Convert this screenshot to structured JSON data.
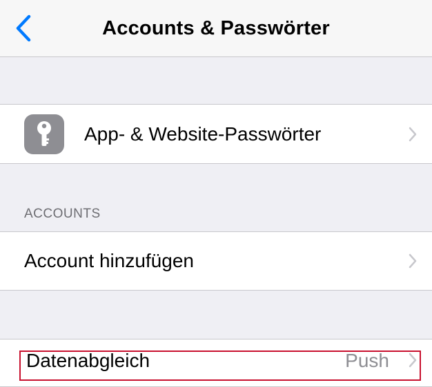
{
  "navbar": {
    "title": "Accounts & Passwörter",
    "back_icon": "chevron-left-icon",
    "accent": "#007aff"
  },
  "passwords_row": {
    "label": "App- & Website-Passwörter",
    "icon": "key-icon",
    "chevron": "chevron-right-icon"
  },
  "accounts_section": {
    "header": "ACCOUNTS",
    "add_account_label": "Account hinzufügen"
  },
  "fetch_row": {
    "label": "Datenabgleich",
    "value": "Push",
    "highlight_color": "#c8102e"
  }
}
